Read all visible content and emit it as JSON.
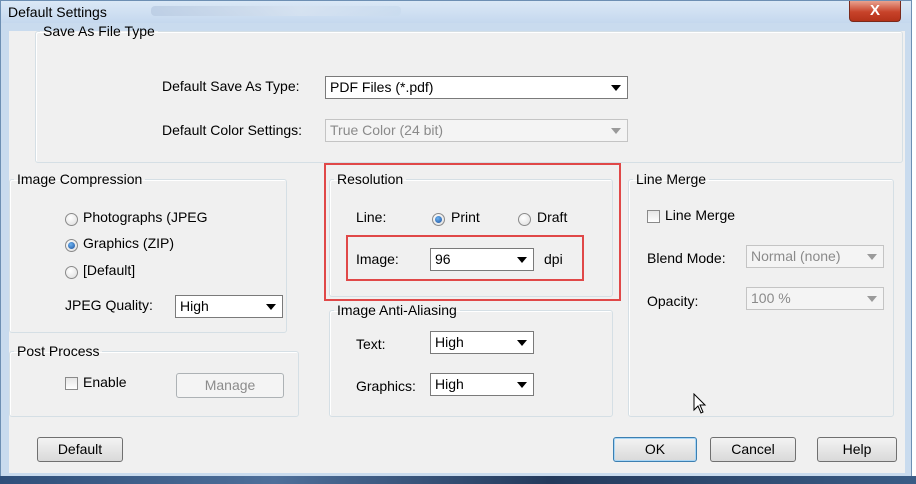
{
  "window": {
    "title": "Default Settings",
    "close_label": "X"
  },
  "save_as": {
    "legend": "Save As File Type",
    "default_type_label": "Default Save As Type:",
    "default_type_value": "PDF Files (*.pdf)",
    "color_settings_label": "Default Color Settings:",
    "color_settings_value": "True Color (24 bit)"
  },
  "image_compression": {
    "legend": "Image Compression",
    "options": [
      {
        "label": "Photographs (JPEG",
        "checked": false
      },
      {
        "label": "Graphics (ZIP)",
        "checked": true
      },
      {
        "label": "[Default]",
        "checked": false
      }
    ],
    "jpeg_quality_label": "JPEG Quality:",
    "jpeg_quality_value": "High"
  },
  "resolution": {
    "legend": "Resolution",
    "line_label": "Line:",
    "print_label": "Print",
    "draft_label": "Draft",
    "print_checked": true,
    "image_label": "Image:",
    "image_value": "96",
    "unit": "dpi"
  },
  "anti_aliasing": {
    "legend": "Image Anti-Aliasing",
    "text_label": "Text:",
    "text_value": "High",
    "graphics_label": "Graphics:",
    "graphics_value": "High"
  },
  "line_merge": {
    "legend": "Line Merge",
    "checkbox_label": "Line Merge",
    "checked": false,
    "blend_mode_label": "Blend Mode:",
    "blend_mode_value": "Normal (none)",
    "opacity_label": "Opacity:",
    "opacity_value": "100 %"
  },
  "post_process": {
    "legend": "Post Process",
    "enable_label": "Enable",
    "enabled": false,
    "manage_label": "Manage"
  },
  "buttons": {
    "default_label": "Default",
    "ok_label": "OK",
    "cancel_label": "Cancel",
    "help_label": "Help"
  },
  "colors": {
    "highlight": "#e04848",
    "window_frame": "#c9dbee",
    "dialog_bg": "#f0f0f0"
  },
  "icons": {
    "cursor": "mouse-pointer-icon",
    "combo_arrow": "chevron-down-icon"
  }
}
